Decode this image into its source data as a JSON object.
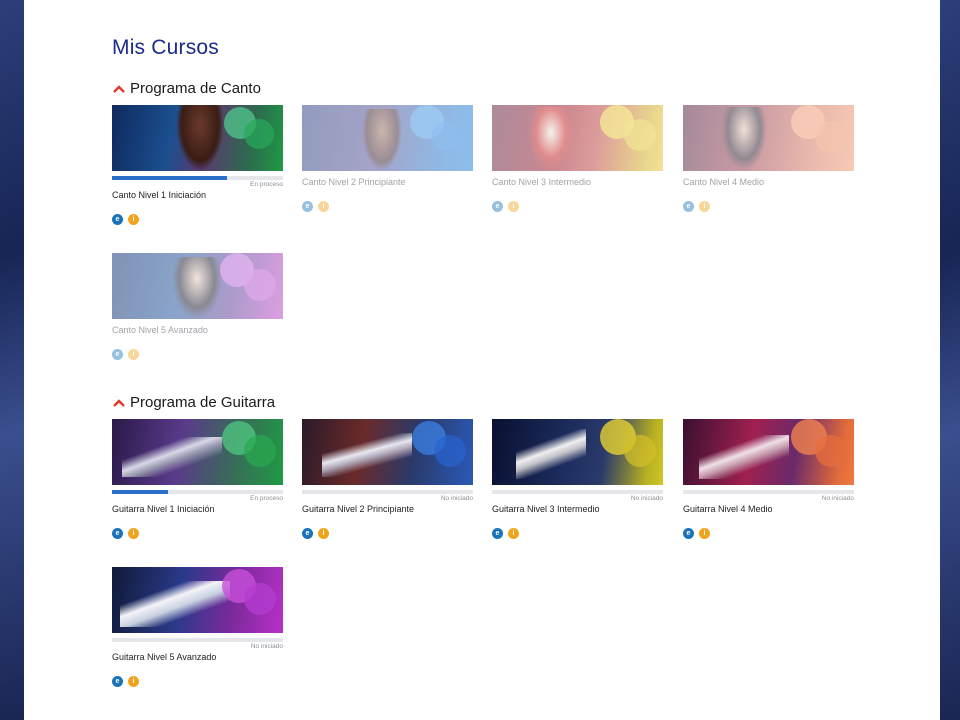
{
  "page": {
    "title": "Mis Cursos"
  },
  "colors": {
    "title": "#1c2a8a",
    "caret": "#e23a2a",
    "progress": "#2a6fc9",
    "badge_blue": "#1a72b8",
    "badge_orange": "#f0a41e"
  },
  "sections": [
    {
      "title": "Programa de Canto",
      "icon": "chevron-up-icon",
      "courses": [
        {
          "name": "Canto Nivel 1 Iniciación",
          "status": "En proceso",
          "progress": 0.67,
          "enabled": true,
          "badges": [
            "e",
            "i"
          ]
        },
        {
          "name": "Canto Nivel 2 Principiante",
          "status": "",
          "progress": null,
          "enabled": false,
          "badges": [
            "e",
            "i"
          ]
        },
        {
          "name": "Canto Nivel 3 Intermedio",
          "status": "",
          "progress": null,
          "enabled": false,
          "badges": [
            "e",
            "i"
          ]
        },
        {
          "name": "Canto Nivel 4 Medio",
          "status": "",
          "progress": null,
          "enabled": false,
          "badges": [
            "e",
            "i"
          ]
        },
        {
          "name": "Canto Nivel 5 Avanzado",
          "status": "",
          "progress": null,
          "enabled": false,
          "badges": [
            "e",
            "i"
          ]
        }
      ]
    },
    {
      "title": "Programa de Guitarra",
      "icon": "chevron-up-icon",
      "courses": [
        {
          "name": "Guitarra Nivel 1 Iniciación",
          "status": "En proceso",
          "progress": 0.33,
          "enabled": true,
          "badges": [
            "e",
            "i"
          ]
        },
        {
          "name": "Guitarra Nivel 2 Principiante",
          "status": "No iniciado",
          "progress": 0,
          "enabled": true,
          "badges": [
            "e",
            "i"
          ]
        },
        {
          "name": "Guitarra Nivel 3 Intermedio",
          "status": "No iniciado",
          "progress": 0,
          "enabled": true,
          "badges": [
            "e",
            "i"
          ]
        },
        {
          "name": "Guitarra Nivel 4 Medio",
          "status": "No iniciado",
          "progress": 0,
          "enabled": true,
          "badges": [
            "e",
            "i"
          ]
        },
        {
          "name": "Guitarra Nivel 5 Avanzado",
          "status": "No iniciado",
          "progress": 0,
          "enabled": true,
          "badges": [
            "e",
            "i"
          ]
        }
      ]
    }
  ]
}
